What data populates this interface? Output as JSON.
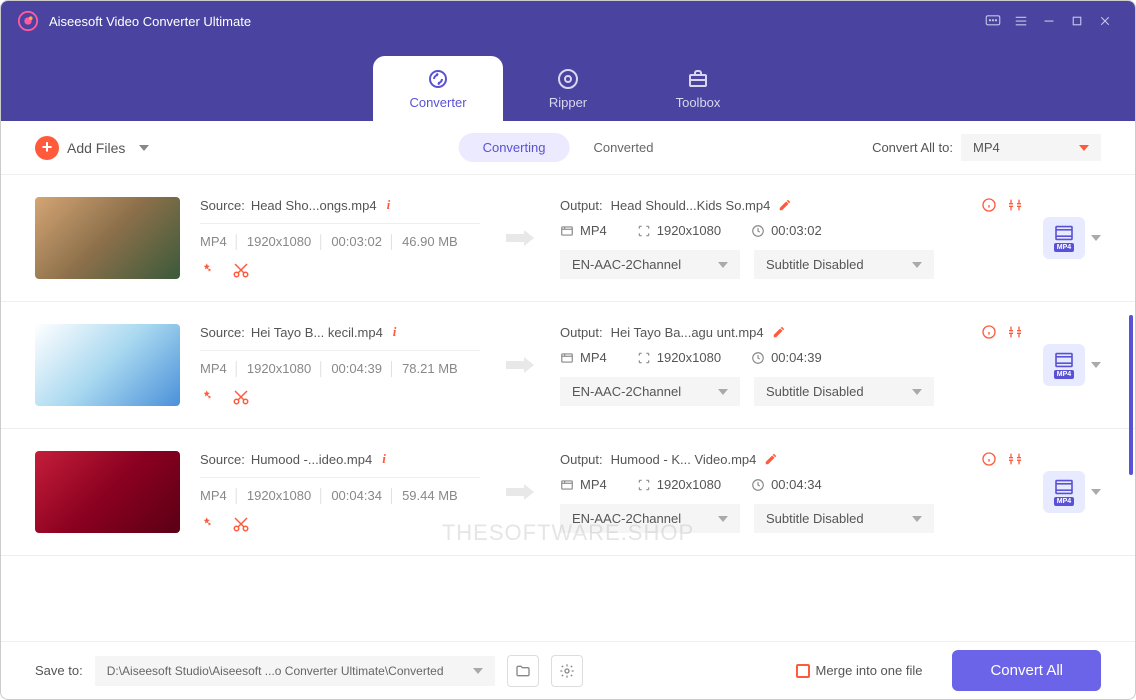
{
  "app": {
    "title": "Aiseesoft Video Converter Ultimate"
  },
  "tabs": {
    "converter": "Converter",
    "ripper": "Ripper",
    "toolbox": "Toolbox"
  },
  "toolbar": {
    "add_files": "Add Files",
    "converting": "Converting",
    "converted": "Converted",
    "convert_all_to": "Convert All to:",
    "format_selected": "MP4"
  },
  "items": [
    {
      "source_label": "Source: ",
      "source_file": "Head Sho...ongs.mp4",
      "fmt": "MP4",
      "res": "1920x1080",
      "dur": "00:03:02",
      "size": "46.90 MB",
      "output_label": "Output: ",
      "output_file": "Head Should...Kids So.mp4",
      "out_fmt": "MP4",
      "out_res": "1920x1080",
      "out_dur": "00:03:02",
      "audio": "EN-AAC-2Channel",
      "subtitle": "Subtitle Disabled",
      "badge": "MP4"
    },
    {
      "source_label": "Source: ",
      "source_file": "Hei Tayo B... kecil.mp4",
      "fmt": "MP4",
      "res": "1920x1080",
      "dur": "00:04:39",
      "size": "78.21 MB",
      "output_label": "Output: ",
      "output_file": "Hei Tayo Ba...agu unt.mp4",
      "out_fmt": "MP4",
      "out_res": "1920x1080",
      "out_dur": "00:04:39",
      "audio": "EN-AAC-2Channel",
      "subtitle": "Subtitle Disabled",
      "badge": "MP4"
    },
    {
      "source_label": "Source: ",
      "source_file": "Humood -...ideo.mp4",
      "fmt": "MP4",
      "res": "1920x1080",
      "dur": "00:04:34",
      "size": "59.44 MB",
      "output_label": "Output: ",
      "output_file": "Humood - K... Video.mp4",
      "out_fmt": "MP4",
      "out_res": "1920x1080",
      "out_dur": "00:04:34",
      "audio": "EN-AAC-2Channel",
      "subtitle": "Subtitle Disabled",
      "badge": "MP4"
    }
  ],
  "footer": {
    "save_to": "Save to:",
    "path": "D:\\Aiseesoft Studio\\Aiseesoft ...o Converter Ultimate\\Converted",
    "merge": "Merge into one file",
    "convert_all": "Convert All"
  },
  "watermark": "THESOFTWARE.SHOP"
}
